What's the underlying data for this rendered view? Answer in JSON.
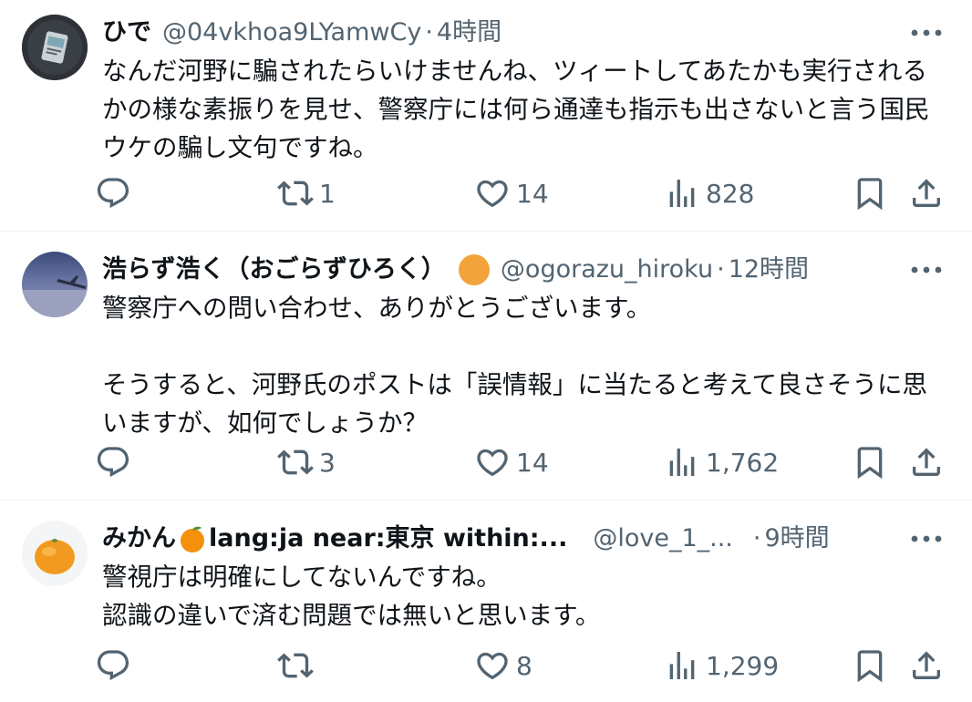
{
  "tweets": [
    {
      "display_name": "ひで",
      "handle": "@04vkhoa9LYamwCy",
      "separator": "·",
      "time": "4時間",
      "text": "なんだ河野に騙されたらいけませんね、ツィートしてあたかも実行されるかの様な素振りを見せ、警察庁には何ら通達も指示も出さないと言う国民ウケの騙し文句ですね。",
      "avatar_icon": "avatar-image",
      "replies": "",
      "reposts": "1",
      "likes": "14",
      "views": "828"
    },
    {
      "display_name": "浩らず浩く（おごらずひろく）",
      "badge_color": "#f2a33a",
      "handle": "@ogorazu_hiroku",
      "separator": "·",
      "time": "12時間",
      "text": "警察庁への問い合わせ、ありがとうございます。\n\nそうすると、河野氏のポストは「誤情報」に当たると考えて良さそうに思いますが、如何でしょうか？",
      "avatar_icon": "avatar-image",
      "replies": "",
      "reposts": "3",
      "likes": "14",
      "views": "1,762"
    },
    {
      "display_name_part1": "みかん",
      "display_name_part2": "lang:ja near:東京 within:...",
      "handle": "@love_1_...",
      "separator": "·",
      "time": "9時間",
      "text": "警視庁は明確にしてないんですね。\n認識の違いで済む問題では無いと思います。",
      "avatar_icon": "avatar-image",
      "replies": "",
      "reposts": "",
      "likes": "8",
      "views": "1,299"
    }
  ],
  "icons": {
    "more": "more-icon",
    "reply": "reply-icon",
    "repost": "repost-icon",
    "like": "like-icon",
    "views": "views-icon",
    "bookmark": "bookmark-icon",
    "share": "share-icon"
  },
  "colors": {
    "text": "#0f1419",
    "muted": "#536471",
    "divider": "#eff3f4",
    "orange": "#f2a33a"
  }
}
